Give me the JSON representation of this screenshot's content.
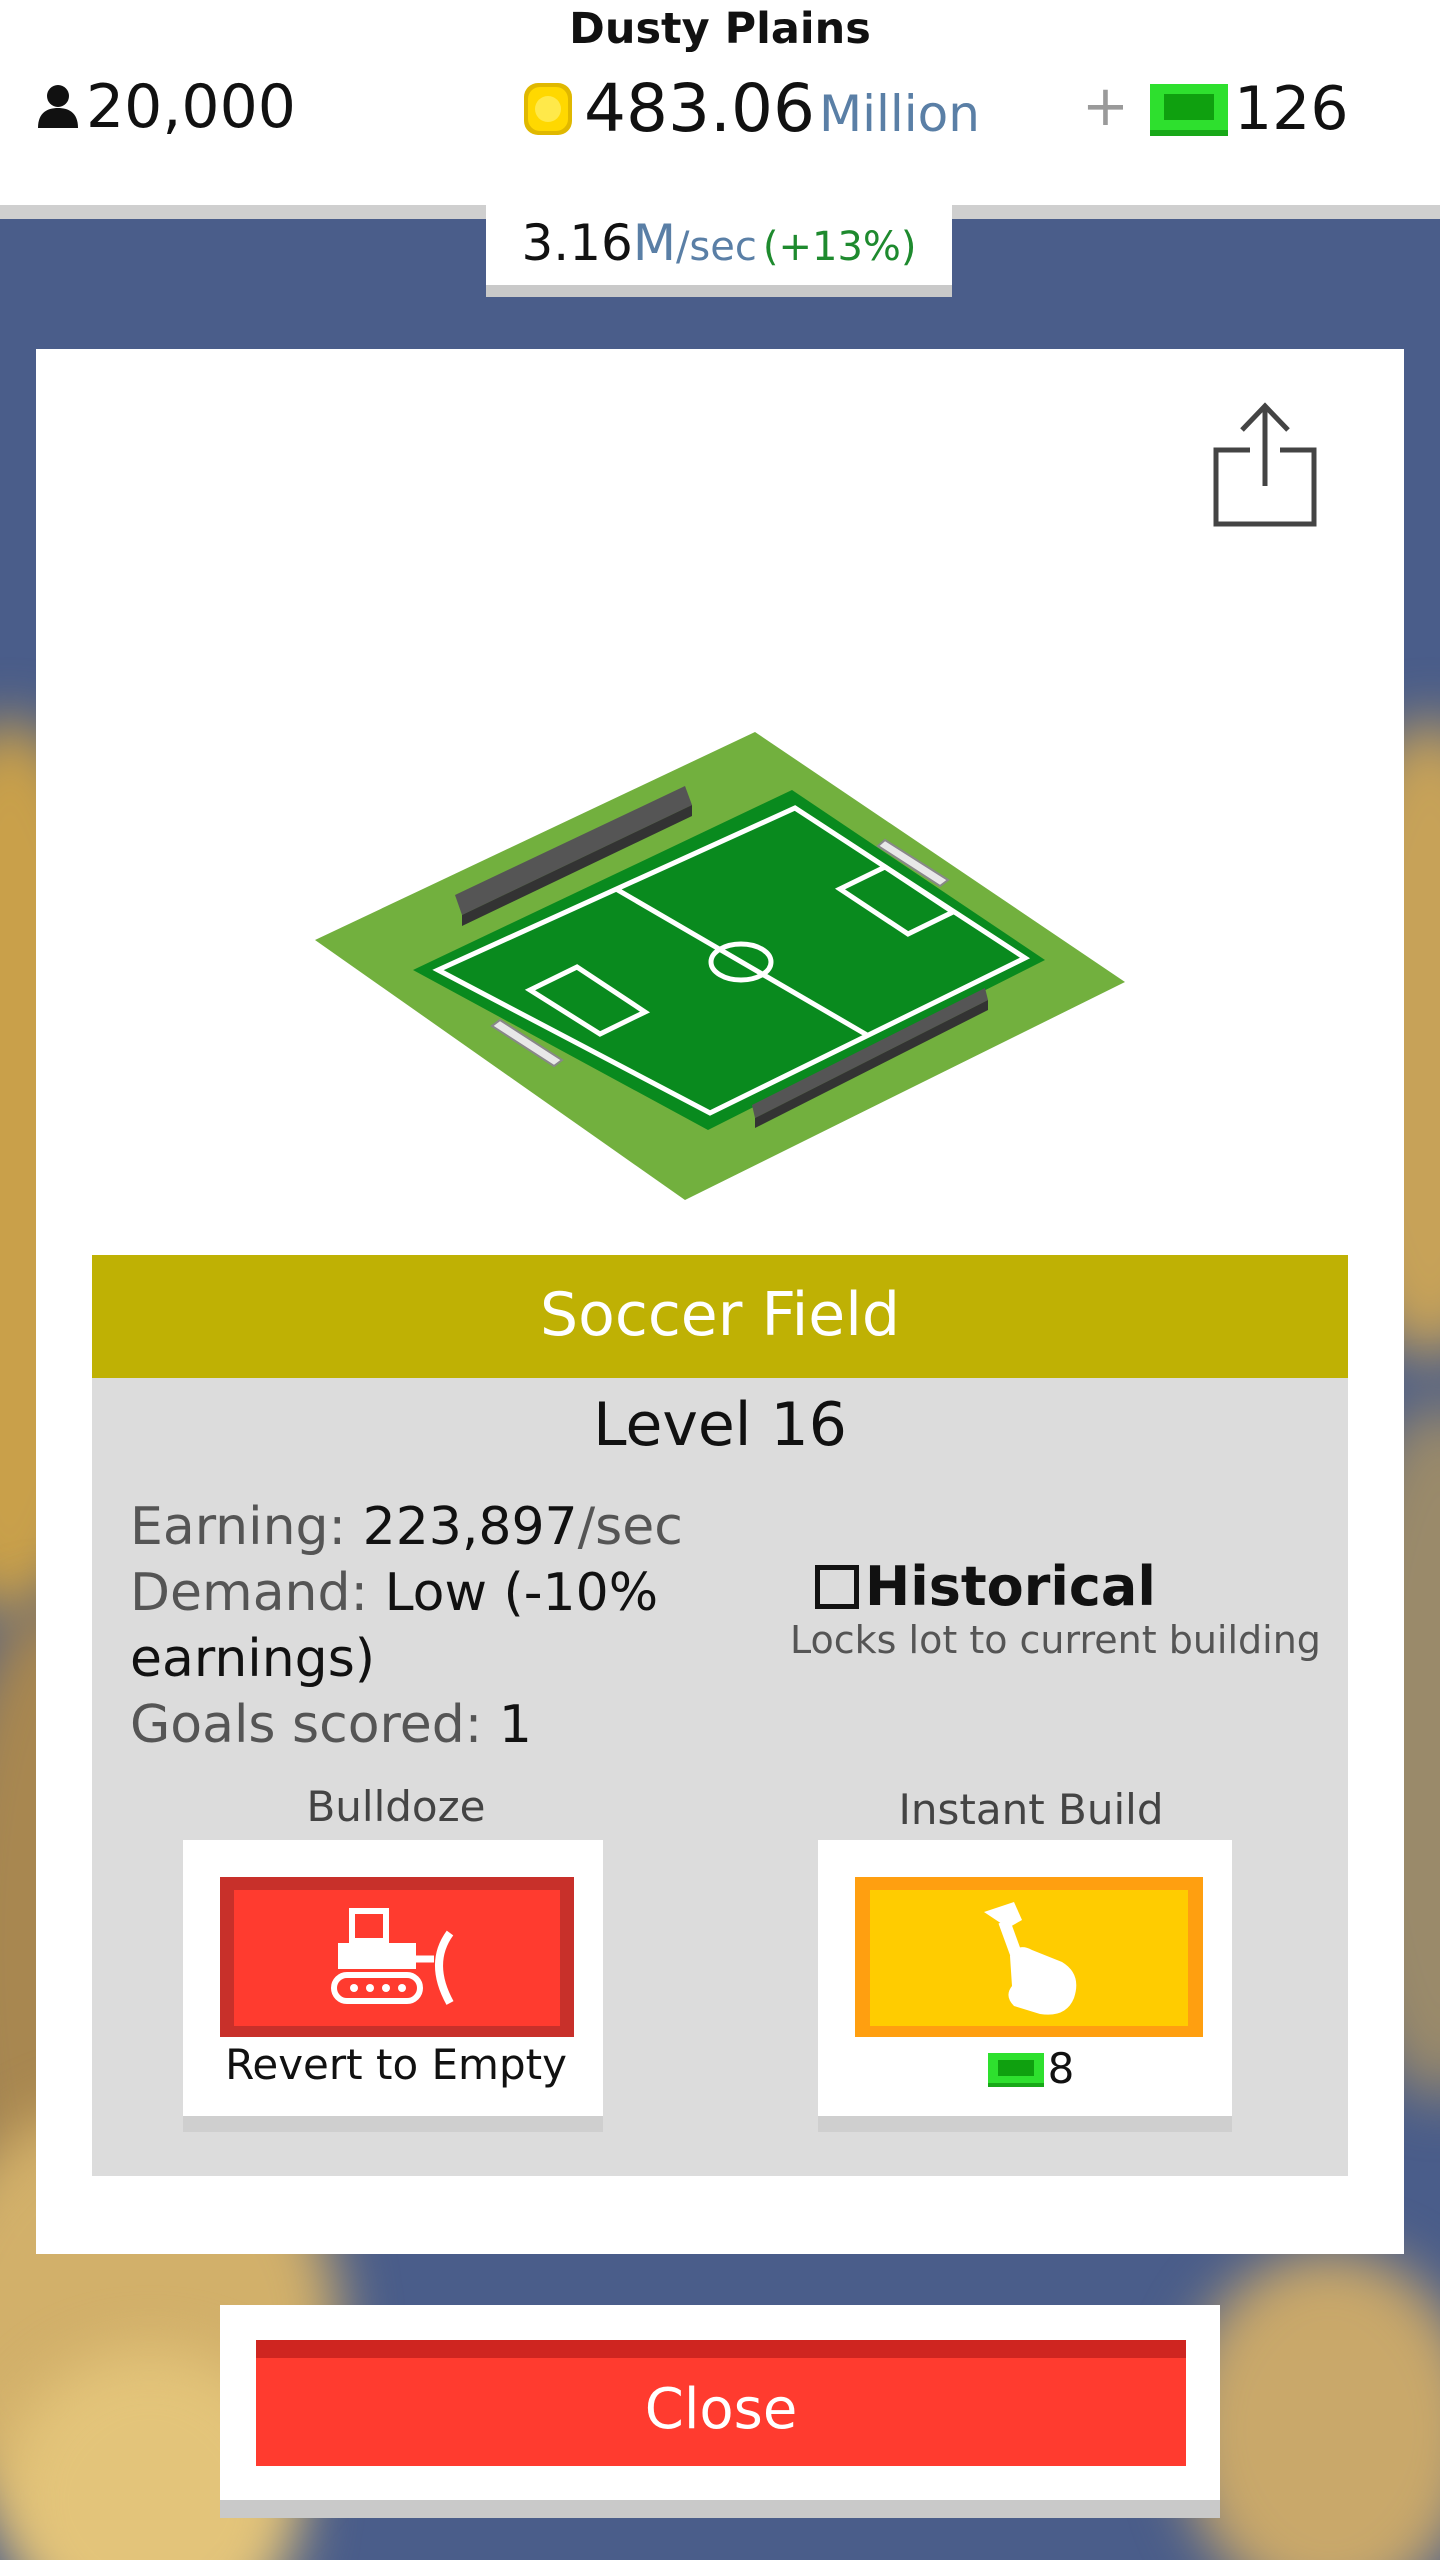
{
  "hud": {
    "city_name": "Dusty Plains",
    "population": "20,000",
    "money_value": "483.06",
    "money_unit": "Million",
    "plus_label": "+",
    "bucks": "126",
    "rate_value": "3.16",
    "rate_unit_m": "M",
    "rate_unit_sec": "/sec",
    "rate_change": "(+13%)"
  },
  "building": {
    "name": "Soccer Field",
    "level": "Level 16",
    "earning_label": "Earning:",
    "earning_value": "223,897",
    "earning_unit": "/sec",
    "demand_label": "Demand:",
    "demand_value_line1": "Low (-10%",
    "demand_value_line2": "earnings)",
    "goals_label": "Goals scored:",
    "goals_value": "1"
  },
  "historical": {
    "label": "Historical",
    "checked": false,
    "description": "Locks lot to current building"
  },
  "actions": {
    "bulldoze_label": "Bulldoze",
    "bulldoze_button": "Revert to Empty",
    "instant_label": "Instant Build",
    "instant_cost": "8"
  },
  "close_label": "Close",
  "icons": [
    "person-icon",
    "coin-icon",
    "bucks-icon",
    "share-icon",
    "bulldozer-icon",
    "hammer-icon"
  ],
  "colors": {
    "title_bar": "#bfb104",
    "bulldoze": "#ff3b2f",
    "instant": "#ffcc00",
    "close": "#ff3b2f",
    "bucks": "#22cc22"
  }
}
